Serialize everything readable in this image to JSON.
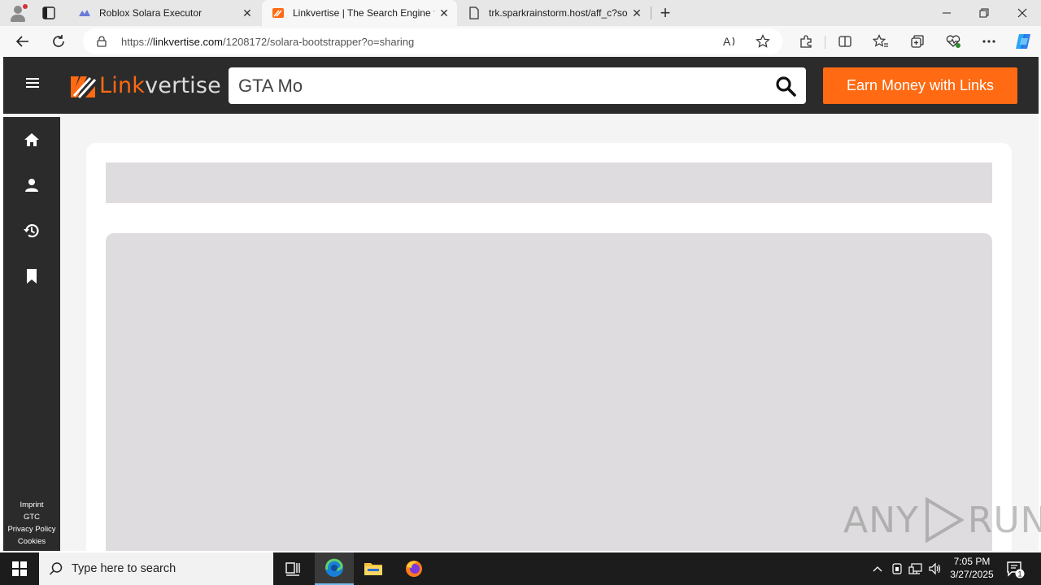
{
  "browser": {
    "tabs": [
      {
        "title": "Roblox Solara Executor",
        "active": false
      },
      {
        "title": "Linkvertise | The Search Engine fo",
        "active": true
      },
      {
        "title": "trk.sparkrainstorm.host/aff_c?sou",
        "active": false
      }
    ],
    "address": {
      "prefix": "https://",
      "domain": "linkvertise.com",
      "path": "/1208172/solara-bootstrapper?o=sharing"
    }
  },
  "linkvertise": {
    "logo_part1": "Link",
    "logo_part2": "vertise",
    "search_value": "GTA Mo",
    "earn_button": "Earn Money with Links",
    "footer_links": [
      "Imprint",
      "GTC",
      "Privacy Policy",
      "Cookies"
    ],
    "brand_color": "#ff6a13"
  },
  "watermark": {
    "left": "ANY",
    "right": "RUN"
  },
  "taskbar": {
    "search_placeholder": "Type here to search",
    "time": "7:05 PM",
    "date": "3/27/2025",
    "notification_count": "1"
  }
}
